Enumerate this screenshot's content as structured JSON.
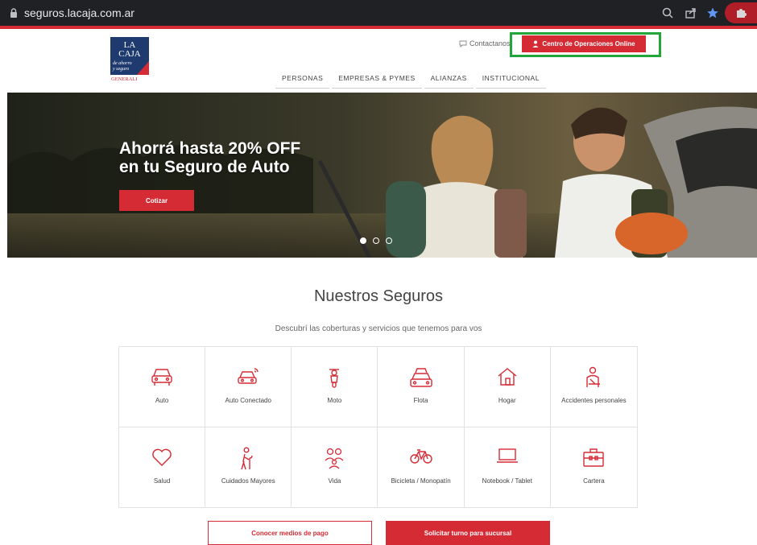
{
  "browser": {
    "url": "seguros.lacaja.com.ar",
    "icons": [
      "lock-icon",
      "zoom-icon",
      "share-icon",
      "bookmark-star-icon",
      "extensions-puzzle-icon"
    ]
  },
  "header": {
    "logo": {
      "line1": "LA",
      "line2": "CAJA",
      "tag1": "de ahorro",
      "tag2": "y seguro",
      "brand": "GENERALI"
    },
    "contact_label": "Contactanos",
    "cta_label": "Centro de Operaciones Online",
    "nav": [
      "PERSONAS",
      "EMPRESAS & PYMES",
      "ALIANZAS",
      "INSTITUCIONAL"
    ]
  },
  "hero": {
    "title_line1": "Ahorrá hasta 20% OFF",
    "title_line2": "en tu Seguro de Auto",
    "button_label": "Cotizar",
    "slide_count": 3,
    "active_slide": 1
  },
  "seguros": {
    "title": "Nuestros Seguros",
    "subtitle": "Descubrí las coberturas y servicios que tenemos para vos",
    "items": [
      {
        "label": "Auto",
        "icon": "car-icon"
      },
      {
        "label": "Auto Conectado",
        "icon": "connected-car-icon"
      },
      {
        "label": "Moto",
        "icon": "motorcycle-icon"
      },
      {
        "label": "Flota",
        "icon": "fleet-icon"
      },
      {
        "label": "Hogar",
        "icon": "home-icon"
      },
      {
        "label": "Accidentes personales",
        "icon": "injured-person-icon"
      },
      {
        "label": "Salud",
        "icon": "heart-icon"
      },
      {
        "label": "Cuidados Mayores",
        "icon": "elderly-icon"
      },
      {
        "label": "Vida",
        "icon": "family-icon"
      },
      {
        "label": "Bicicleta / Monopatín",
        "icon": "bicycle-icon"
      },
      {
        "label": "Notebook / Tablet",
        "icon": "laptop-icon"
      },
      {
        "label": "Cartera",
        "icon": "briefcase-icon"
      }
    ]
  },
  "actions": {
    "pagos_label": "Conocer medios de pago",
    "turno_label": "Solicitar turno para sucursal"
  },
  "colors": {
    "brand_red": "#d52b35",
    "highlight_green": "#21a63a",
    "logo_navy": "#1f3a6e"
  }
}
